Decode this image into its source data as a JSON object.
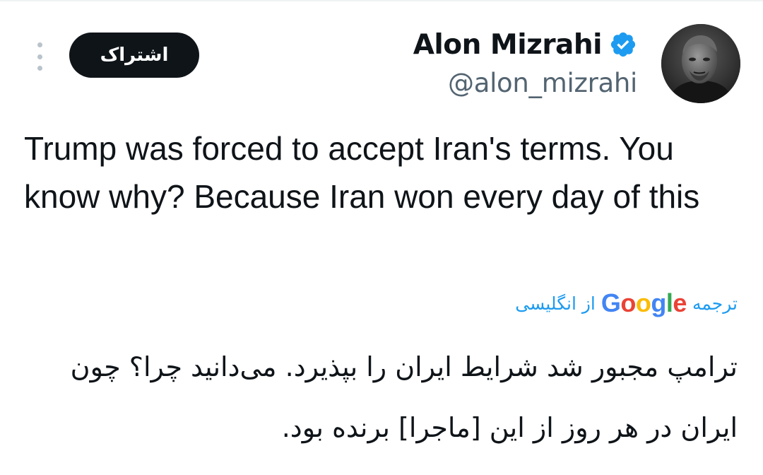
{
  "header": {
    "subscribe_label": "اشتراک",
    "display_name": "Alon Mizrahi",
    "handle": "@alon_mizrahi"
  },
  "tweet": {
    "text": "Trump was forced to accept Iran's terms. You know why? Because Iran won every day of this"
  },
  "translation": {
    "prefix": "ترجمه",
    "google_letters": [
      {
        "char": "G",
        "color": "#4285F4"
      },
      {
        "char": "o",
        "color": "#EA4335"
      },
      {
        "char": "o",
        "color": "#FBBC05"
      },
      {
        "char": "g",
        "color": "#4285F4"
      },
      {
        "char": "l",
        "color": "#34A853"
      },
      {
        "char": "e",
        "color": "#EA4335"
      }
    ],
    "from_language": "از انگلیسی",
    "translated_text": "ترامپ مجبور شد شرایط ایران را بپذیرد. می‌دانید چرا؟ چون ایران در هر روز از این [ماجرا] برنده بود."
  },
  "colors": {
    "text_primary": "#0f1419",
    "text_secondary": "#536471",
    "accent_blue": "#1d9bf0",
    "button_bg": "#0f1419"
  },
  "icons": {
    "more": "more-vertical-icon",
    "verified": "verified-badge-icon"
  }
}
